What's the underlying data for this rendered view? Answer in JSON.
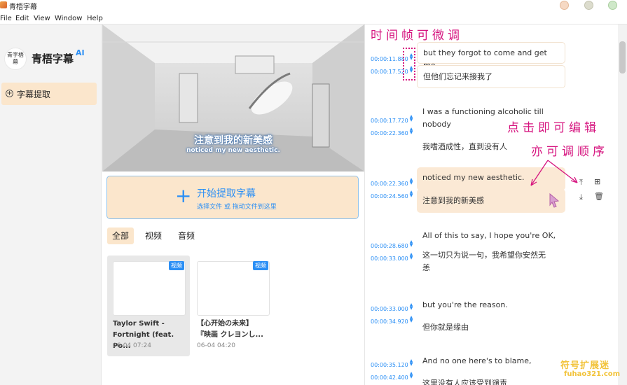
{
  "window": {
    "title": "青梧字幕"
  },
  "menu": [
    "File",
    "Edit",
    "View",
    "Window",
    "Help"
  ],
  "sidebar": {
    "logo_text": "青字梧幕",
    "brand": "青梧字幕",
    "brand_suffix": "AI",
    "items": [
      {
        "label": "字幕提取",
        "icon": "plus-circle-icon",
        "active": true
      }
    ]
  },
  "preview": {
    "subtitle_cn": "注意到我的新美感",
    "subtitle_en": "noticed my new aesthetic."
  },
  "extract": {
    "label": "开始提取字幕",
    "hint": "选择文件 或 拖动文件到这里"
  },
  "filters": [
    "全部",
    "视频",
    "音频"
  ],
  "files": [
    {
      "badge": "视频",
      "name_line1": "Taylor Swift -",
      "name_line2": "Fortnight (feat. Po...",
      "date": "06-04 07:24",
      "selected": true
    },
    {
      "badge": "视频",
      "name_line1": "【心开始の未来】",
      "name_line2": "『映画 クレヨンし...",
      "date": "06-04 04:20",
      "selected": false
    }
  ],
  "segments": [
    {
      "start": "00:00:11.880",
      "end": "00:00:17.520",
      "en": "but they forgot to come and get me.",
      "cn": "但他们忘记来接我了"
    },
    {
      "start": "00:00:17.720",
      "end": "00:00:22.360",
      "en_lines": [
        "I was a functioning alcoholic till",
        "nobody"
      ],
      "cn": "我嗜酒成性，直到没有人"
    },
    {
      "start": "00:00:22.360",
      "end": "00:00:24.560",
      "en": "noticed my new aesthetic.",
      "cn": "注意到我的新美感",
      "active": true
    },
    {
      "start": "00:00:28.680",
      "end": "00:00:33.000",
      "en": "All of this to say, I hope you're OK,",
      "cn_lines": [
        "这一切只为说一句，我希望你安然无",
        "恙"
      ]
    },
    {
      "start": "00:00:33.000",
      "end": "00:00:34.920",
      "en": "but you're the reason.",
      "cn": "但你就是缘由"
    },
    {
      "start": "00:00:35.120",
      "end": "00:00:42.400",
      "en": "And no one here's to blame,",
      "cn": "这里没有人应该受到谴责"
    }
  ],
  "annotations": {
    "fine_tune": "时间帧可微调",
    "click_edit": "点击即可编辑",
    "reorder": "亦可调顺序"
  },
  "watermark": {
    "line1": "符号扩展迷",
    "line2": "fuhao321.com"
  },
  "colors": {
    "accent": "#2b8ff5",
    "highlight": "#fbe6cc",
    "annotation": "#d6147f"
  }
}
